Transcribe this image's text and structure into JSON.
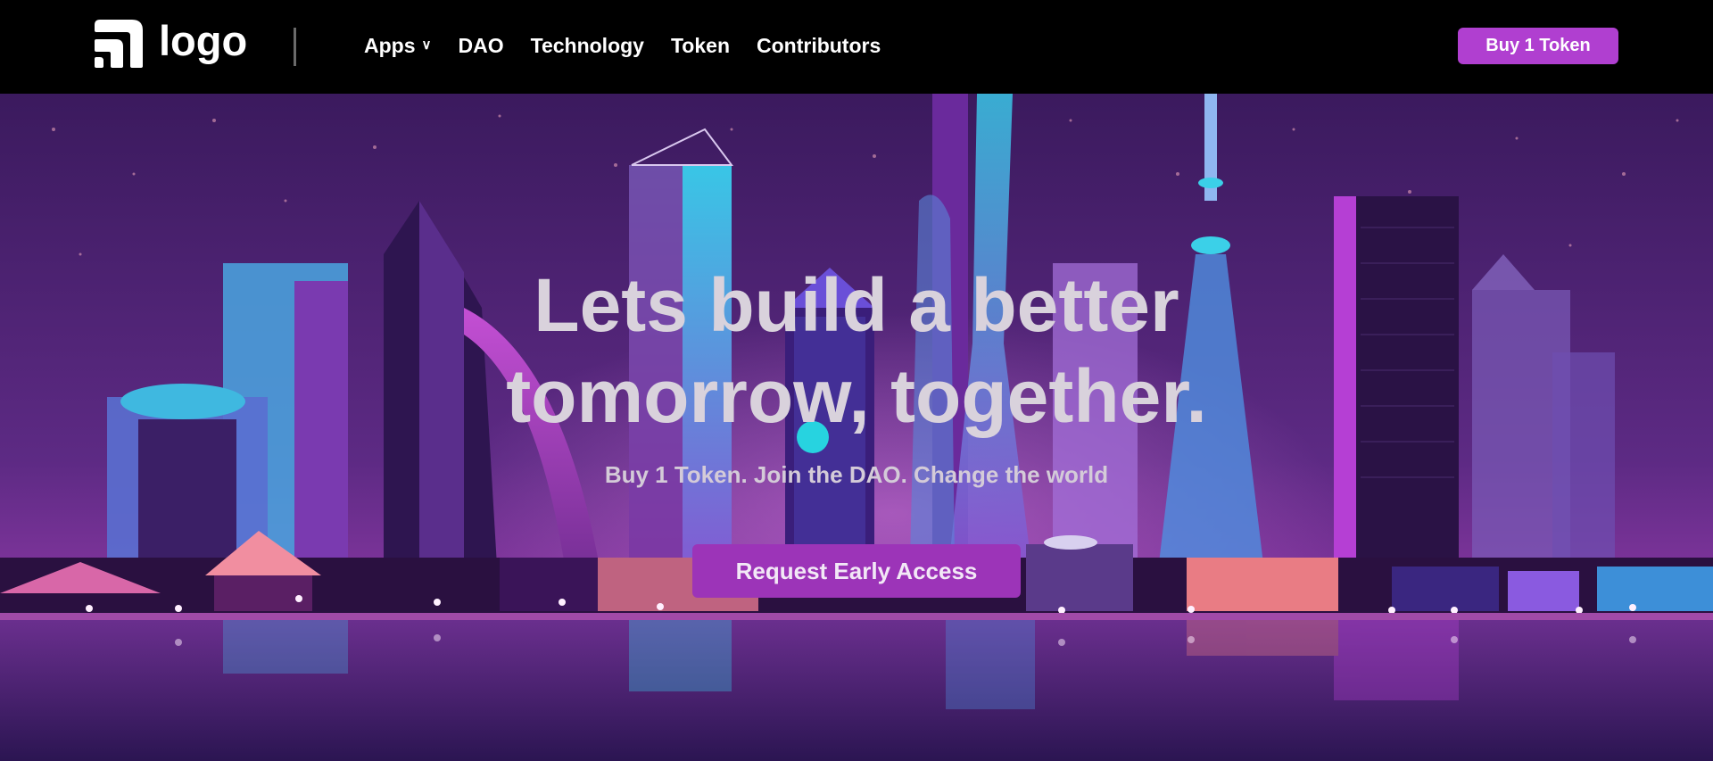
{
  "header": {
    "logo_text": "logo",
    "nav": [
      {
        "label": "Apps",
        "has_dropdown": true
      },
      {
        "label": "DAO"
      },
      {
        "label": "Technology"
      },
      {
        "label": "Token"
      },
      {
        "label": "Contributors"
      }
    ],
    "cta_label": "Buy 1 Token"
  },
  "hero": {
    "headline_line1": "Lets build a better",
    "headline_line2": "tomorrow, together.",
    "subline": "Buy 1 Token. Join the DAO. Change the world",
    "cta_label": "Request Early Access"
  },
  "colors": {
    "header_bg": "#000000",
    "accent": "#b03fd0",
    "hero_cta": "#9c34b8",
    "headline": "#d9d2dc"
  },
  "icons": {
    "logo": "signal-arcs-icon",
    "apps_dropdown": "chevron-down-icon"
  }
}
